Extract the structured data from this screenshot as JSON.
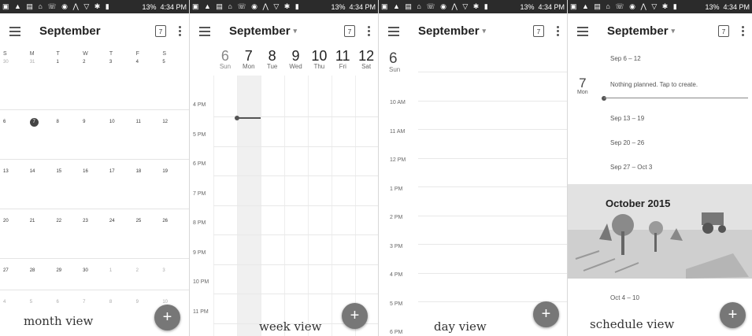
{
  "status_bar": {
    "icons": "▣ ▲ ▤ ⌂ ☏ ◉ ⋀ ▽ ✱ ▮",
    "battery": "13%",
    "clock": "4:34 PM"
  },
  "month_view": {
    "title": "September",
    "today_icon": "7",
    "weekdays": [
      "S",
      "M",
      "T",
      "W",
      "T",
      "F",
      "S"
    ],
    "weeks": [
      [
        "30",
        "31",
        "1",
        "2",
        "3",
        "4",
        "5"
      ],
      [
        "6",
        "7",
        "8",
        "9",
        "10",
        "11",
        "12"
      ],
      [
        "13",
        "14",
        "15",
        "16",
        "17",
        "18",
        "19"
      ],
      [
        "20",
        "21",
        "22",
        "23",
        "24",
        "25",
        "26"
      ],
      [
        "27",
        "28",
        "29",
        "30",
        "1",
        "2",
        "3"
      ],
      [
        "4",
        "5",
        "6",
        "7",
        "8",
        "9",
        "10"
      ]
    ],
    "today": "7",
    "caption": "month view",
    "fab": "+"
  },
  "week_view": {
    "title": "September",
    "caret": "▾",
    "today_icon": "7",
    "days": [
      {
        "n": "6",
        "d": "Sun"
      },
      {
        "n": "7",
        "d": "Mon"
      },
      {
        "n": "8",
        "d": "Tue"
      },
      {
        "n": "9",
        "d": "Wed"
      },
      {
        "n": "10",
        "d": "Thu"
      },
      {
        "n": "11",
        "d": "Fri"
      },
      {
        "n": "12",
        "d": "Sat"
      }
    ],
    "hours": [
      "4 PM",
      "5 PM",
      "6 PM",
      "7 PM",
      "8 PM",
      "9 PM",
      "10 PM",
      "11 PM"
    ],
    "caption": "week view",
    "fab": "+"
  },
  "day_view": {
    "title": "September",
    "caret": "▾",
    "today_icon": "7",
    "day_num": "6",
    "day_name": "Sun",
    "hours": [
      "10 AM",
      "11 AM",
      "12 PM",
      "1 PM",
      "2 PM",
      "3 PM",
      "4 PM",
      "5 PM",
      "6 PM"
    ],
    "caption": "day view",
    "fab": "+"
  },
  "schedule_view": {
    "title": "September",
    "caret": "▾",
    "today_icon": "7",
    "week1": "Sep 6 – 12",
    "date_num": "7",
    "date_day": "Mon",
    "empty_text": "Nothing planned. Tap to create.",
    "week2": "Sep 13 – 19",
    "week3": "Sep 20 – 26",
    "week4": "Sep 27 – Oct 3",
    "banner_title": "October 2015",
    "week5": "Oct 4 – 10",
    "caption": "schedule view",
    "fab": "+"
  }
}
